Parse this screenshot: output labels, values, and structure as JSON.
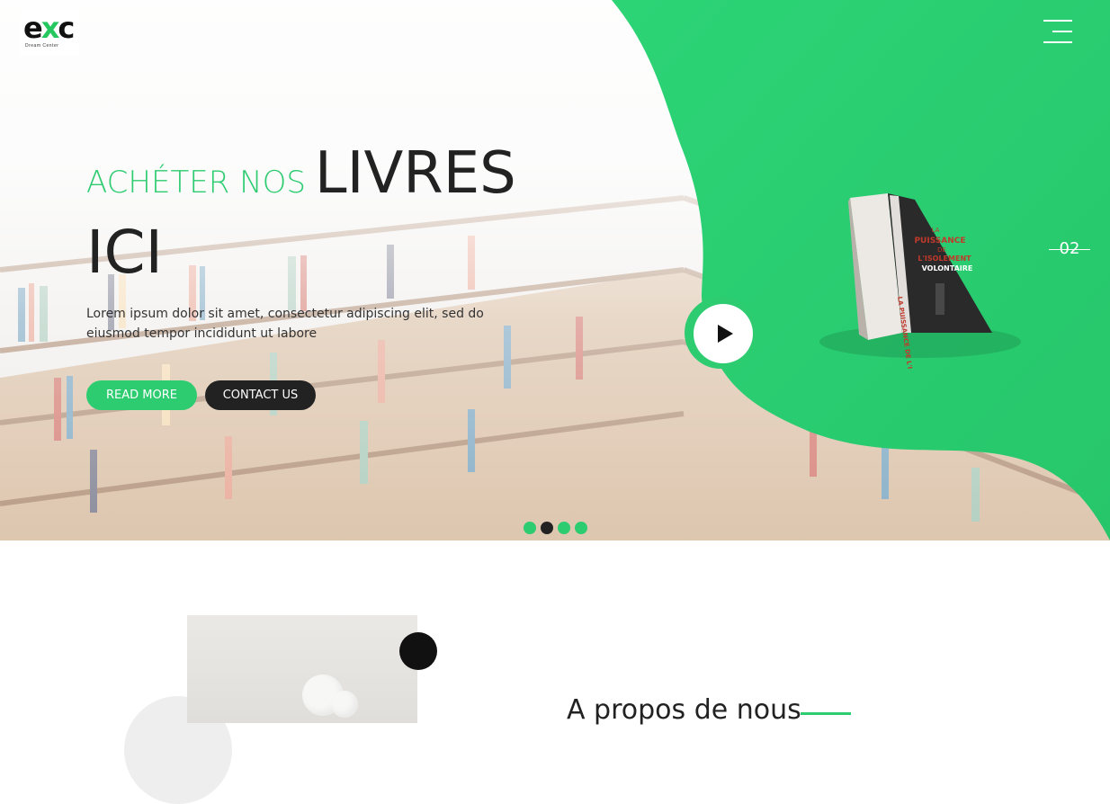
{
  "brand": {
    "logo_text_left": "e",
    "logo_text_x": "x",
    "logo_text_right": "c",
    "tagline": "Dream Center"
  },
  "hero": {
    "title_green": "ACHÉTER NOS",
    "title_dark": "LIVRES",
    "title_line2": "ICI",
    "description": "Lorem ipsum dolor sit amet, consectetur adipiscing elit, sed do eiusmod tempor incididunt ut labore",
    "read_more_label": "READ MORE",
    "contact_label": "CONTACT US",
    "slide_number": "02",
    "slider_dots": 4,
    "active_dot_index": 1
  },
  "book": {
    "title_line1": "LA",
    "title_line2": "PUISSANCE",
    "title_line3": "DE",
    "title_line4": "L'ISOLEMENT",
    "title_line5": "VOLONTAIRE",
    "spine_text": "LA PUISSANCE DE L'ISOLEMENT VOLONTAIRE"
  },
  "about": {
    "heading": "A propos de nous"
  },
  "colors": {
    "accent": "#2ecc71",
    "dark": "#222222"
  },
  "icons": {
    "menu": "hamburger-menu-icon",
    "play": "play-icon"
  }
}
